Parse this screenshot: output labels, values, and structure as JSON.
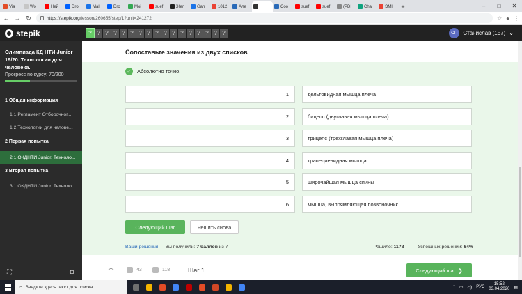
{
  "browser": {
    "tabs": [
      {
        "label": "Via",
        "color": "#e34c26"
      },
      {
        "label": "Wo",
        "color": "#c6c6c6"
      },
      {
        "label": "Ней",
        "color": "#ff0000"
      },
      {
        "label": "Dro",
        "color": "#0061ff"
      },
      {
        "label": "Mal",
        "color": "#1a73e8"
      },
      {
        "label": "Dro",
        "color": "#0061ff"
      },
      {
        "label": "Moi",
        "color": "#34a853"
      },
      {
        "label": "suef",
        "color": "#ff0000"
      },
      {
        "label": "Жел",
        "color": "#222222"
      },
      {
        "label": "Gan",
        "color": "#1a73e8"
      },
      {
        "label": "1012",
        "color": "#ea4335"
      },
      {
        "label": "Але",
        "color": "#2a6ab8"
      },
      {
        "label": "",
        "color": "#333333",
        "active": true
      },
      {
        "label": "Coo",
        "color": "#2a6ab8"
      },
      {
        "label": "suef",
        "color": "#ff0000"
      },
      {
        "label": "suef",
        "color": "#ff0000"
      },
      {
        "label": "(PDI",
        "color": "#888888"
      },
      {
        "label": "Cha",
        "color": "#10a37f"
      },
      {
        "label": "ЭМI",
        "color": "#ea4335"
      }
    ],
    "new_tab": "+",
    "window_controls": [
      "–",
      "□",
      "✕"
    ],
    "url_host": "https://stepik.org",
    "url_path": "/lesson/260655/step/1?unit=241272"
  },
  "header": {
    "logo": "stepik",
    "steps": [
      "?",
      "?",
      "?",
      "?",
      "?",
      "?",
      "?",
      "?",
      "?",
      "?",
      "?",
      "?",
      "?",
      "?",
      "?",
      "?",
      "?"
    ],
    "current_step_index": 0,
    "user_initials": "СП",
    "user_name": "Станислав (157)",
    "user_chevron": "⌄"
  },
  "sidebar": {
    "course_title": "Олимпиада КД НТИ Junior 19/20. Технологии для человека.",
    "progress_label": "Прогресс по курсу:",
    "progress_value": "70/200",
    "progress_fraction": 0.35,
    "sections": [
      {
        "label": "1  Общая информация"
      },
      {
        "label": "2  Первая попытка"
      },
      {
        "label": "3  Вторая попытка"
      }
    ],
    "lessons": [
      {
        "label": "1.1  Регламент Отборочног..."
      },
      {
        "label": "1.2  Технологии для челове..."
      },
      {
        "label": "2.1  ОКДНТИ Junior. Техноло...",
        "active": true
      },
      {
        "label": "3.1  ОКДНТИ Junior. Техноло..."
      }
    ]
  },
  "task": {
    "title": "Сопоставьте значения из двух списков",
    "feedback": "Абсолютно точно.",
    "pairs": [
      {
        "left": "1",
        "right": "дельтовидная мышца плеча"
      },
      {
        "left": "2",
        "right": "бицепс (двуглавая мышца плеча)"
      },
      {
        "left": "3",
        "right": "трицепс (трехглавая мышца плеча)"
      },
      {
        "left": "4",
        "right": "трапециевидная мышца"
      },
      {
        "left": "5",
        "right": "широчайшая мышца спины"
      },
      {
        "left": "6",
        "right": "мышца, выпрямляющая позвоночник"
      }
    ],
    "next_step_label": "Следующий шаг",
    "retry_label": "Решить снова",
    "your_solutions": "Ваши решения",
    "score_prefix": "Вы получили:",
    "score_value": "7 баллов",
    "score_suffix": "из 7",
    "solved_label": "Решило:",
    "solved_value": "1178",
    "success_label": "Успешных решений:",
    "success_value": "64%"
  },
  "footer": {
    "likes": "43",
    "dislikes": "118",
    "step_label": "Шаг 1",
    "next_step_label": "Следующий шаг",
    "arrow": "❯"
  },
  "taskbar": {
    "search_placeholder": "Введите здесь текст для поиска",
    "apps": [
      "#6f6f6f",
      "#f4b400",
      "#e34c26",
      "#4285f4",
      "#c00000",
      "#e34c26",
      "#d24726",
      "#f4b400",
      "#4285f4"
    ],
    "lang": "РУС",
    "time": "15:52",
    "date": "03.04.2020"
  }
}
